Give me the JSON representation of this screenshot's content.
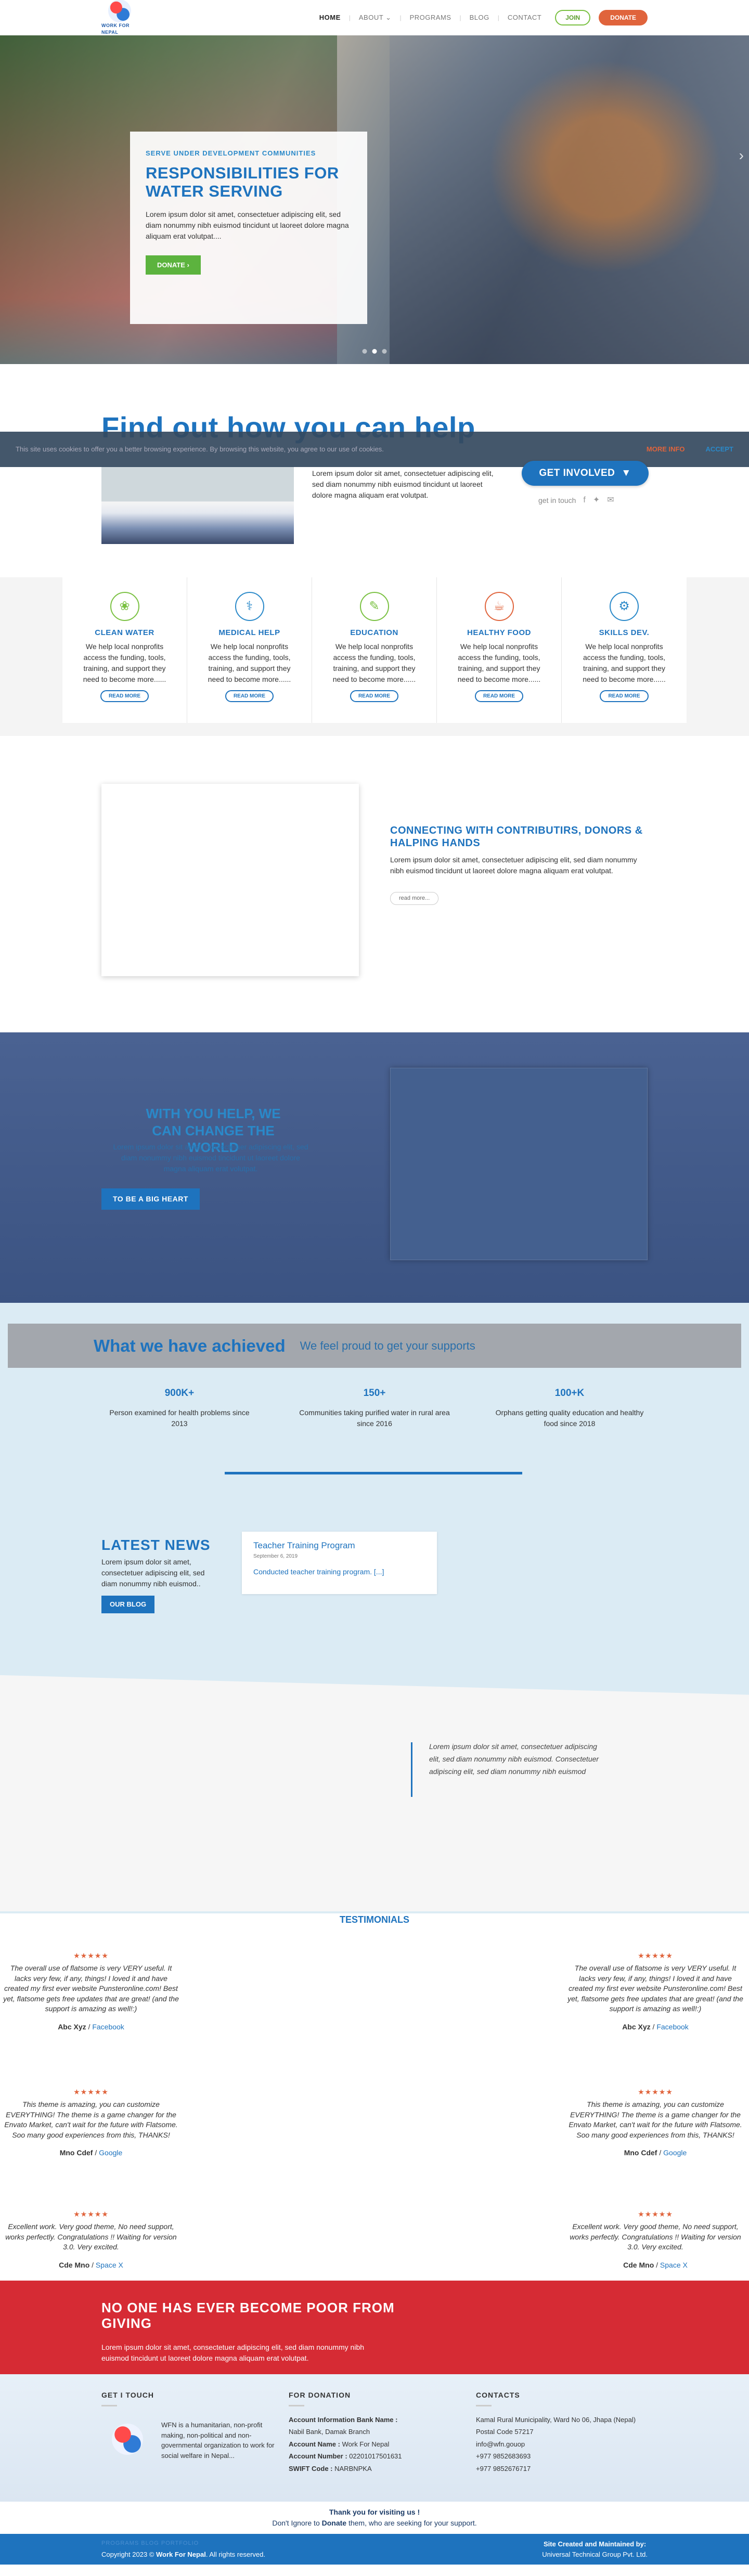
{
  "header": {
    "logo_text": "WORK FOR NEPAL",
    "nav": [
      {
        "label": "HOME",
        "active": true
      },
      {
        "label": "ABOUT",
        "has_dropdown": true
      },
      {
        "label": "PROGRAMS"
      },
      {
        "label": "BLOG"
      },
      {
        "label": "CONTACT"
      }
    ],
    "join_label": "JOIN",
    "donate_label": "DONATE"
  },
  "hero": {
    "kicker": "SERVE UNDER DEVELOPMENT COMMUNITIES",
    "title": "RESPONSIBILITIES FOR WATER SERVING",
    "text": "Lorem ipsum dolor sit amet, consectetuer adipiscing elit, sed diam nonummy nibh euismod tincidunt ut laoreet dolore magna aliquam erat volutpat....",
    "button_label": "DONATE",
    "slide_count": 3,
    "active_slide": 2
  },
  "cookie": {
    "text": "This site uses cookies to offer you a better browsing experience. By browsing this website, you agree to our use of cookies.",
    "more_info": "MORE INFO",
    "accept": "ACCEPT"
  },
  "help": {
    "title": "Find out how you can help",
    "text": "Lorem ipsum dolor sit amet, consectetuer adipiscing elit, sed diam nonummy nibh euismod tincidunt ut laoreet dolore magna aliquam erat volutpat.",
    "involved_label": "GET INVOLVED",
    "get_in_touch": "get in touch"
  },
  "services": [
    {
      "title": "CLEAN WATER",
      "icon": "water-drop-icon",
      "color": "#7ac142",
      "glyph": "❀",
      "text": "We help local nonprofits access the funding, tools, training, and support they need to become more......",
      "button": "READ MORE"
    },
    {
      "title": "MEDICAL HELP",
      "icon": "medical-icon",
      "color": "#2a89c9",
      "glyph": "⚕",
      "text": "We help local nonprofits access the funding, tools, training, and support they need to become more......",
      "button": "READ MORE"
    },
    {
      "title": "EDUCATION",
      "icon": "education-icon",
      "color": "#7ac142",
      "glyph": "✎",
      "text": "We help local nonprofits access the funding, tools, training, and support they need to become more......",
      "button": "READ MORE"
    },
    {
      "title": "HEALTHY FOOD",
      "icon": "food-icon",
      "color": "#e0643c",
      "glyph": "☕",
      "text": "We help local nonprofits access the funding, tools, training, and support they need to become more......",
      "button": "READ MORE"
    },
    {
      "title": "SKILLS DEV.",
      "icon": "skills-icon",
      "color": "#2a89c9",
      "glyph": "⚙",
      "text": "We help local nonprofits access the funding, tools, training, and support they need to become more......",
      "button": "READ MORE"
    }
  ],
  "connect": {
    "title": "CONNECTING WITH CONTRIBUTIRS, DONORS & HALPING HANDS",
    "text": "Lorem ipsum dolor sit amet, consectetuer adipiscing elit, sed diam nonummy nibh euismod tincidunt ut laoreet dolore magna aliquam erat volutpat.",
    "button": "read more..."
  },
  "heart": {
    "title": "WITH YOU HELP, WE CAN CHANGE THE WORLD",
    "text": "Lorem ipsum dolor sit amet, consectetuer adipiscing elit, sed diam nonummy nibh euismod tincidunt ut laoreet dolore magna aliquam erat volutpat.",
    "button": "TO BE A BIG HEART"
  },
  "achieved": {
    "title": "What we have achieved",
    "subtitle": "We feel proud to get your supports",
    "stats": [
      {
        "number": "900K+",
        "label": "Person examined for health problems since 2013"
      },
      {
        "number": "150+",
        "label": "Communities taking purified water in rural area since 2016"
      },
      {
        "number": "100+K",
        "label": "Orphans getting quality education and healthy food since 2018"
      }
    ]
  },
  "news": {
    "title": "LATEST NEWS",
    "text": "Lorem ipsum dolor sit amet, consectetuer adipiscing elit, sed diam nonummy nibh euismod..",
    "button": "OUR BLOG",
    "card": {
      "title": "Teacher Training Program",
      "date": "September 6, 2019",
      "text": "Conducted teacher training program. [...]"
    }
  },
  "quote": {
    "text": "Lorem ipsum dolor sit amet, consectetuer adipiscing elit, sed diam nonummy nibh euismod. Consectetuer adipiscing elit, sed diam nonummy nibh euismod"
  },
  "testimonials": {
    "title": "TESTIMONIALS",
    "items": [
      {
        "stars": "★★★★★",
        "text": "The overall use of flatsome is very VERY useful. It lacks very few, if any, things! I loved it and have created my first ever website Punsteronline.com! Best yet, flatsome gets free updates that are great! (and the support is amazing as well!:)",
        "name": "Abc Xyz",
        "source": "Facebook"
      },
      {
        "stars": "★★★★★",
        "text": "This theme is amazing, you can customize EVERYTHING! The theme is a game changer for the Envato Market, can't wait for the future with Flatsome. Soo many good experiences from this, THANKS!",
        "name": "Mno Cdef",
        "source": "Google"
      },
      {
        "stars": "★★★★★",
        "text": "Excellent work. Very good theme, No need support, works perfectly. Congratulations !! Waiting for version 3.0. Very excited.",
        "name": "Cde Mno",
        "source": "Space X"
      }
    ]
  },
  "cta": {
    "title": "NO ONE HAS EVER BECOME POOR FROM GIVING",
    "text": "Lorem ipsum dolor sit amet, consectetuer adipiscing elit, sed diam nonummy nibh euismod tincidunt ut laoreet dolore magna aliquam erat volutpat."
  },
  "footer": {
    "touch_head": "GET I TOUCH",
    "about": "WFN is a humanitarian, non-profit making, non-political and non-governmental organization to work for social welfare in Nepal...",
    "donation_head": "FOR DONATION",
    "bank_title": "Account Information Bank Name :",
    "bank_name": "Nabil Bank, Damak Branch",
    "account_name_label": "Account Name :",
    "account_name": "Work For Nepal",
    "account_number_label": "Account Number :",
    "account_number": "02201017501631",
    "swift_label": "SWIFT Code :",
    "swift": "NARBNPKA",
    "contacts_head": "CONTACTS",
    "address": "Kamal Rural Municipality, Ward No 06, Jhapa (Nepal) Postal Code 57217",
    "email": "info@wfn.gouop",
    "phone1": "+977 9852683693",
    "phone2": "+977 9852676717"
  },
  "thanks": {
    "line1": "Thank you for visiting us !",
    "line2_pre": "Don't Ignore to ",
    "line2_bold": "Donate",
    "line2_post": " them, who are seeking for your support."
  },
  "bottom": {
    "links": "PROGRAMS   BLOG   PORTFOLIO",
    "copyright_pre": "Copyright 2023 © ",
    "copyright_bold": "Work For Nepal",
    "copyright_post": ". All rights reserved.",
    "credit_line1": "Site Created and Maintained by:",
    "credit_line2": "Universal Technical Group Pvt. Ltd."
  },
  "colors": {
    "primary": "#1e73be",
    "accent": "#e0643c",
    "green": "#5cb33e",
    "cta_red": "#d62b34"
  }
}
